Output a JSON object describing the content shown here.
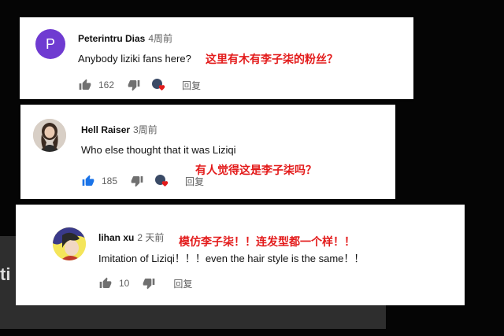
{
  "colors": {
    "accent_red": "#e31b1b",
    "avatar_purple": "#6f3bd1",
    "icon_gray": "#707070",
    "like_active_blue": "#1a73e8"
  },
  "backdrop": {
    "edge_glyph": "ti"
  },
  "comments": [
    {
      "author": "Peterintru Dias",
      "time": "4周前",
      "avatar_letter": "P",
      "text": "Anybody liziki fans here?",
      "translation": "这里有木有李子柒的粉丝？",
      "likes": "162",
      "reply": "回复",
      "creator_heart": true,
      "like_active": false,
      "icons": {
        "like": "thumbs-up-icon",
        "dislike": "thumbs-down-icon",
        "heart": "creator-heart-icon"
      }
    },
    {
      "author": "Hell Raiser",
      "time": "3周前",
      "text": "Who else thought that it was Liziqi",
      "translation": "有人觉得这是李子柒吗？",
      "likes": "185",
      "reply": "回复",
      "creator_heart": true,
      "like_active": true,
      "icons": {
        "like": "thumbs-up-icon",
        "dislike": "thumbs-down-icon",
        "heart": "creator-heart-icon"
      }
    },
    {
      "author": "lihan xu",
      "time": "2 天前",
      "text": "Imitation of Liziqi！！！even the hair style is the same！！",
      "translation": "模仿李子柒！！连发型都一个样！！",
      "likes": "10",
      "reply": "回复",
      "creator_heart": false,
      "like_active": false,
      "icons": {
        "like": "thumbs-up-icon",
        "dislike": "thumbs-down-icon"
      }
    }
  ]
}
